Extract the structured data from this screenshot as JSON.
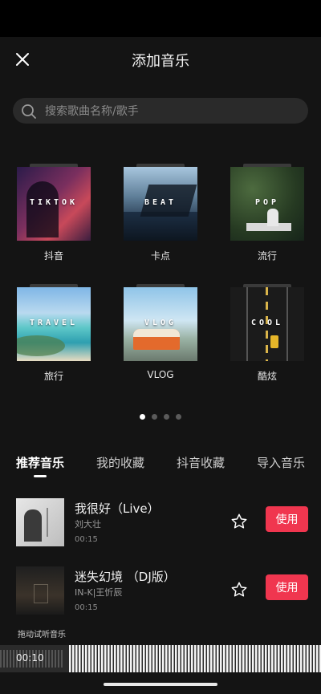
{
  "header": {
    "title": "添加音乐"
  },
  "search": {
    "placeholder": "搜索歌曲名称/歌手"
  },
  "categories": [
    {
      "cover_text": "TIKTOK",
      "label": "抖音"
    },
    {
      "cover_text": "BEAT",
      "label": "卡点"
    },
    {
      "cover_text": "POP",
      "label": "流行"
    },
    {
      "cover_text": "TRAVEL",
      "label": "旅行"
    },
    {
      "cover_text": "VLOG",
      "label": "VLOG"
    },
    {
      "cover_text": "COOL",
      "label": "酷炫"
    }
  ],
  "pagination": {
    "current": 1,
    "total": 4
  },
  "tabs": [
    "推荐音乐",
    "我的收藏",
    "抖音收藏",
    "导入音乐"
  ],
  "songs": [
    {
      "title": "我很好（Live）",
      "artist": "刘大壮",
      "duration": "00:15",
      "use_label": "使用"
    },
    {
      "title": "迷失幻境 （DJ版）",
      "artist": "IN-K|王忻辰",
      "duration": "00:15",
      "use_label": "使用"
    }
  ],
  "player": {
    "hint": "拖动试听音乐",
    "time": "00:10"
  },
  "colors": {
    "accent": "#f0364f",
    "background": "#141414"
  }
}
